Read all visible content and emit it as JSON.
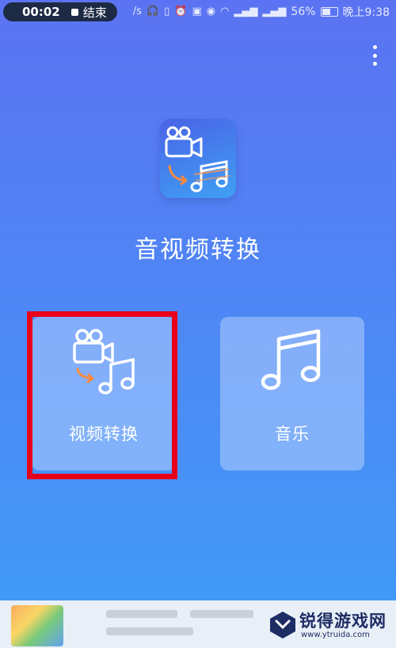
{
  "status_bar": {
    "rec_time": "00:02",
    "rec_stop_label": "结束",
    "battery_percent": "56%",
    "clock": "晚上9:38",
    "net_speed": "/s"
  },
  "app": {
    "title": "音视频转换",
    "logo_icon": "video-to-music-icon"
  },
  "cards": [
    {
      "label": "视频转换",
      "icon": "video-to-music-icon",
      "highlighted": true
    },
    {
      "label": "音乐",
      "icon": "music-note-icon",
      "highlighted": false
    }
  ],
  "colors": {
    "bg_top": "#5b73f2",
    "bg_bottom": "#3f9cf7",
    "highlight": "#e8001b"
  },
  "watermark": {
    "name": "锐得游戏网",
    "url": "www.ytruida.com"
  }
}
